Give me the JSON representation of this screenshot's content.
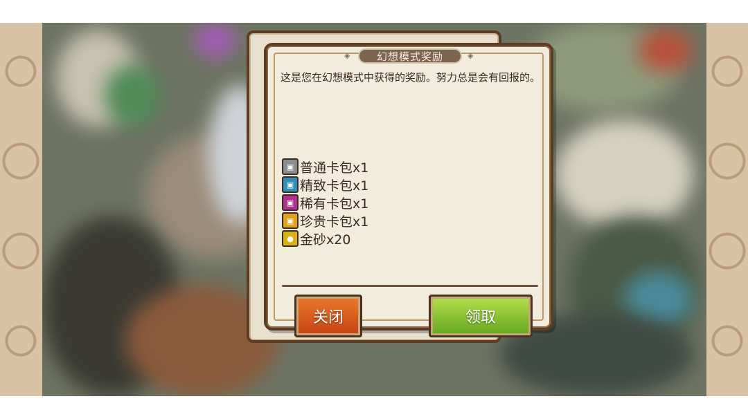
{
  "dialog": {
    "title": "幻想模式奖励",
    "description": "这是您在幻想模式中获得的奖励。努力总是会有回报的。",
    "rewards": [
      {
        "label": "普通卡包x1",
        "icon": "common-card-pack-icon",
        "color": "#8a8d90"
      },
      {
        "label": "精致卡包x1",
        "icon": "fine-card-pack-icon",
        "color": "#2f8fb8"
      },
      {
        "label": "稀有卡包x1",
        "icon": "rare-card-pack-icon",
        "color": "#b0308f"
      },
      {
        "label": "珍贵卡包x1",
        "icon": "precious-card-pack-icon",
        "color": "#e0a21c"
      },
      {
        "label": "金砂x20",
        "icon": "gold-sand-icon",
        "color": "#d9b313"
      }
    ],
    "close_label": "关闭",
    "claim_label": "领取"
  },
  "colors": {
    "close_button": "#d85a20",
    "claim_button": "#8cc234",
    "frame": "#5a3d24",
    "panel": "#f2ecdd"
  }
}
